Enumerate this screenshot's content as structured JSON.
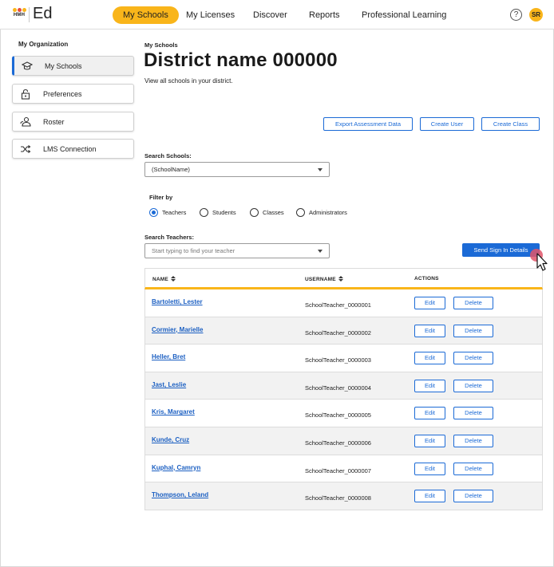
{
  "app": {
    "logo_text": "HMH",
    "brand": "Ed"
  },
  "nav": {
    "items": [
      {
        "label": "My Schools",
        "active": true
      },
      {
        "label": "My Licenses"
      },
      {
        "label": "Discover"
      },
      {
        "label": "Reports"
      },
      {
        "label": "Professional Learning"
      }
    ],
    "help_glyph": "?",
    "avatar_initials": "SR"
  },
  "sidebar": {
    "heading": "My Organization",
    "items": [
      {
        "label": "My Schools",
        "icon": "school-icon",
        "active": true
      },
      {
        "label": "Preferences",
        "icon": "lock-icon"
      },
      {
        "label": "Roster",
        "icon": "users-icon"
      },
      {
        "label": "LMS Connection",
        "icon": "shuffle-icon"
      }
    ]
  },
  "main": {
    "breadcrumb": "My Schools",
    "title": "District name 000000",
    "subtitle": "View all schools in your district.",
    "actions": {
      "export": "Export Assessment Data",
      "create_user": "Create User",
      "create_class": "Create Class"
    },
    "search_schools": {
      "label": "Search Schools:",
      "value": "(SchoolName)"
    },
    "filter": {
      "label": "Filter by",
      "options": [
        "Teachers",
        "Students",
        "Classes",
        "Administrators"
      ],
      "selected": "Teachers"
    },
    "search_teachers": {
      "label": "Search Teachers:",
      "placeholder": "Start typing to find your teacher"
    },
    "send_sign_in": "Send Sign In Details"
  },
  "table": {
    "headers": {
      "name": "NAME",
      "username": "USERNAME",
      "actions": "ACTIONS"
    },
    "edit_label": "Edit",
    "delete_label": "Delete",
    "rows": [
      {
        "name": "Bartoletti, Lester",
        "username": "SchoolTeacher_0000001"
      },
      {
        "name": "Cormier, Marielle",
        "username": "SchoolTeacher_0000002"
      },
      {
        "name": "Heller, Bret",
        "username": "SchoolTeacher_0000003"
      },
      {
        "name": "Jast, Leslie",
        "username": "SchoolTeacher_0000004"
      },
      {
        "name": "Kris, Margaret",
        "username": "SchoolTeacher_0000005"
      },
      {
        "name": "Kunde, Cruz",
        "username": "SchoolTeacher_0000006"
      },
      {
        "name": "Kuphal, Camryn",
        "username": "SchoolTeacher_0000007"
      },
      {
        "name": "Thompson, Leland",
        "username": "SchoolTeacher_0000008"
      }
    ]
  },
  "colors": {
    "accent_yellow": "#f9b51a",
    "primary_blue": "#1b6ad6",
    "link_blue": "#1b5fc2",
    "row_alt": "#f2f2f2"
  }
}
